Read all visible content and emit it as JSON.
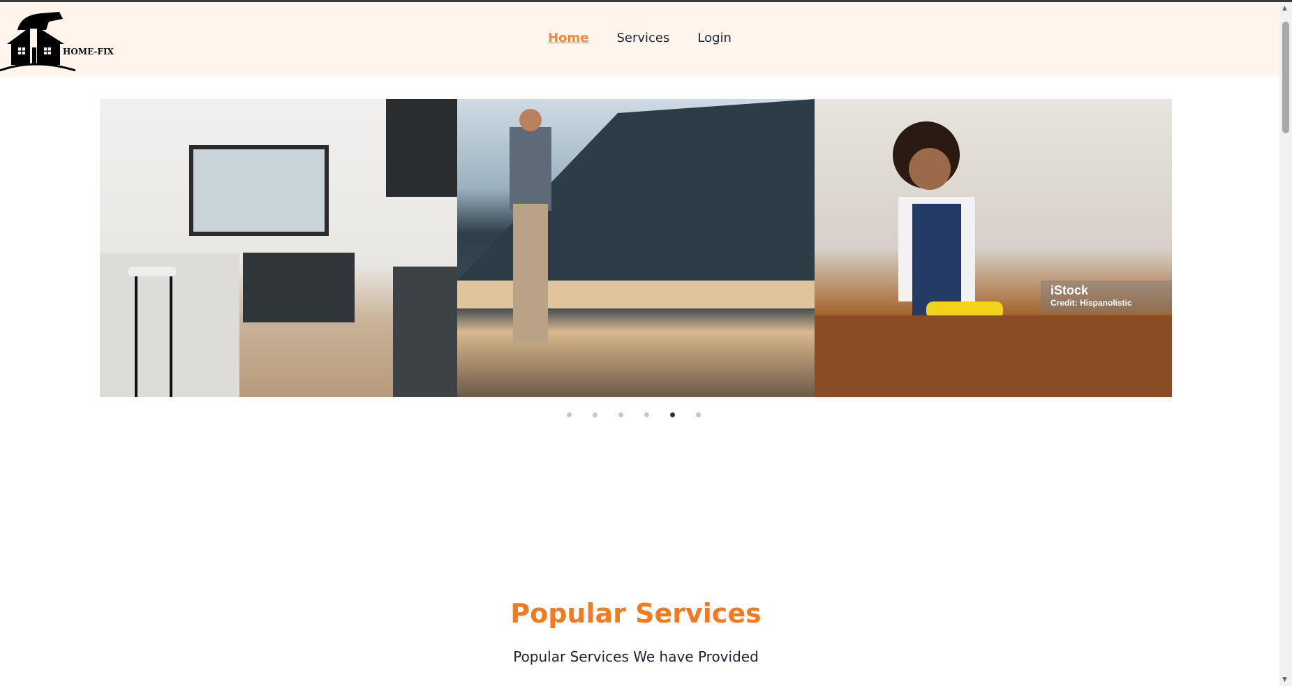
{
  "brand": {
    "name": "HOME-FIX"
  },
  "nav": {
    "items": [
      {
        "label": "Home",
        "active": true
      },
      {
        "label": "Services"
      },
      {
        "label": "Login"
      }
    ]
  },
  "carousel": {
    "watermark": {
      "brand": "iStock",
      "credit": "Credit: Hispanolistic"
    },
    "dot_count": 6,
    "active_index": 4
  },
  "popular": {
    "title": "Popular Services",
    "subtitle": "Popular Services We have Provided"
  },
  "colors": {
    "accent": "#f47920",
    "header_bg": "#fff5ec"
  }
}
